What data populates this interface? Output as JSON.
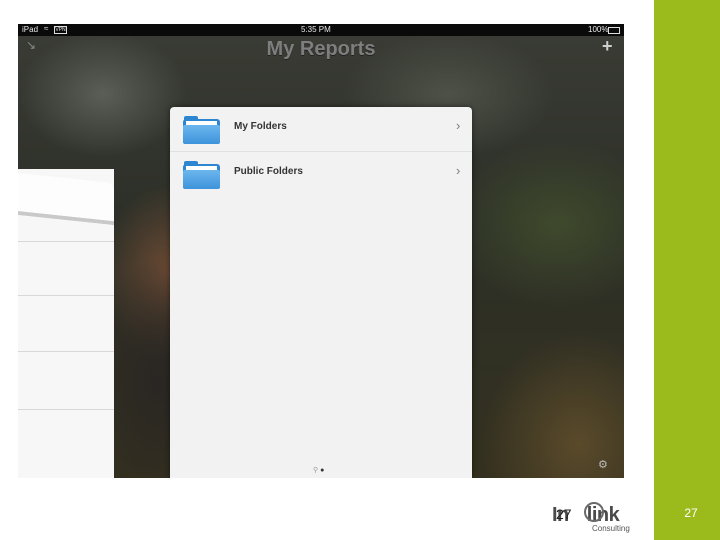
{
  "slide": {
    "number": "27",
    "overlay_number": "27"
  },
  "colors": {
    "accent_green": "#9bbb1c",
    "folder_blue": "#2f86d0"
  },
  "statusbar": {
    "carrier": "iPad",
    "network": "VPN",
    "time": "5:35 PM",
    "battery": "100%"
  },
  "nav": {
    "title": "My Reports",
    "left_icon": "collapse-icon",
    "right_label": "+"
  },
  "folders": [
    {
      "label": "My Folders",
      "icon": "folder-icon"
    },
    {
      "label": "Public Folders",
      "icon": "folder-icon"
    }
  ],
  "logo": {
    "name": "Inter-link",
    "sub": "Consulting"
  }
}
